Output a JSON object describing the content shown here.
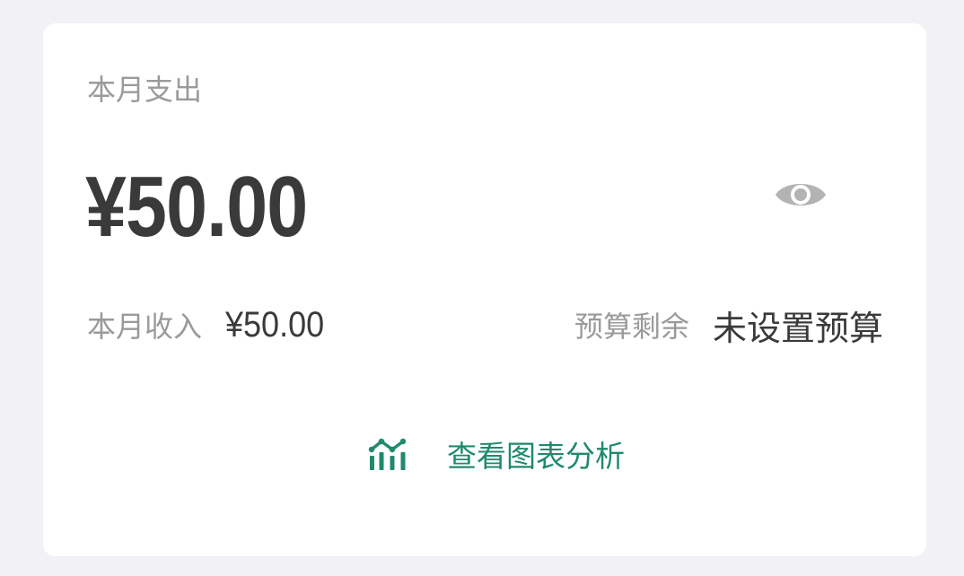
{
  "summary": {
    "expense_label": "本月支出",
    "expense_amount": "¥50.00",
    "income_label": "本月收入",
    "income_amount": "¥50.00",
    "budget_label": "预算剩余",
    "budget_value": "未设置预算"
  },
  "actions": {
    "chart_link_label": "查看图表分析",
    "chart_icon": "bar-chart-icon",
    "visibility_icon": "eye-icon"
  },
  "colors": {
    "accent": "#1f8a6d",
    "primary_text": "#3a3a3a",
    "secondary_text": "#9a9a9a",
    "icon_gray": "#b3b3b3",
    "background": "#f2f2f6",
    "card": "#ffffff"
  }
}
